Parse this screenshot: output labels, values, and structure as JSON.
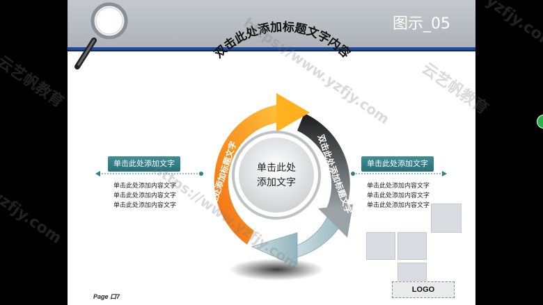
{
  "slide": {
    "title": "图示_05",
    "heading": "双击此处添加标题文字内容",
    "center_text_line1": "单击此处",
    "center_text_line2": "添加文字",
    "orange_arc_text": "双击此处添加标题文字",
    "dark_arc_text": "双击此处添加标题文字"
  },
  "left_panel": {
    "label": "单击此处添加文字",
    "lines": [
      "单击此处添加内容文字",
      "单击此处添加内容文字",
      "单击此处添加内容文字"
    ]
  },
  "right_panel": {
    "label": "单击此处添加文字",
    "lines": [
      "单击此处添加内容文字",
      "单击此处添加内容文字",
      "单击此处添加内容文字"
    ]
  },
  "footer": {
    "page_label": "Page 口7",
    "logo": "LOGO"
  },
  "watermarks": [
    "云艺帆教育",
    "yzfjy.com",
    "https://www.yzfjy.com",
    "云艺帆教育",
    "yzfjy.com",
    "https://www.yzfjy.com"
  ],
  "colors": {
    "header_bar": "#1f4d99",
    "orange_arrow": "#f7941d",
    "dark_arrow": "#3c3c3c",
    "teal_label": "#2f7f87",
    "light_arrow": "#b7d0d6"
  }
}
